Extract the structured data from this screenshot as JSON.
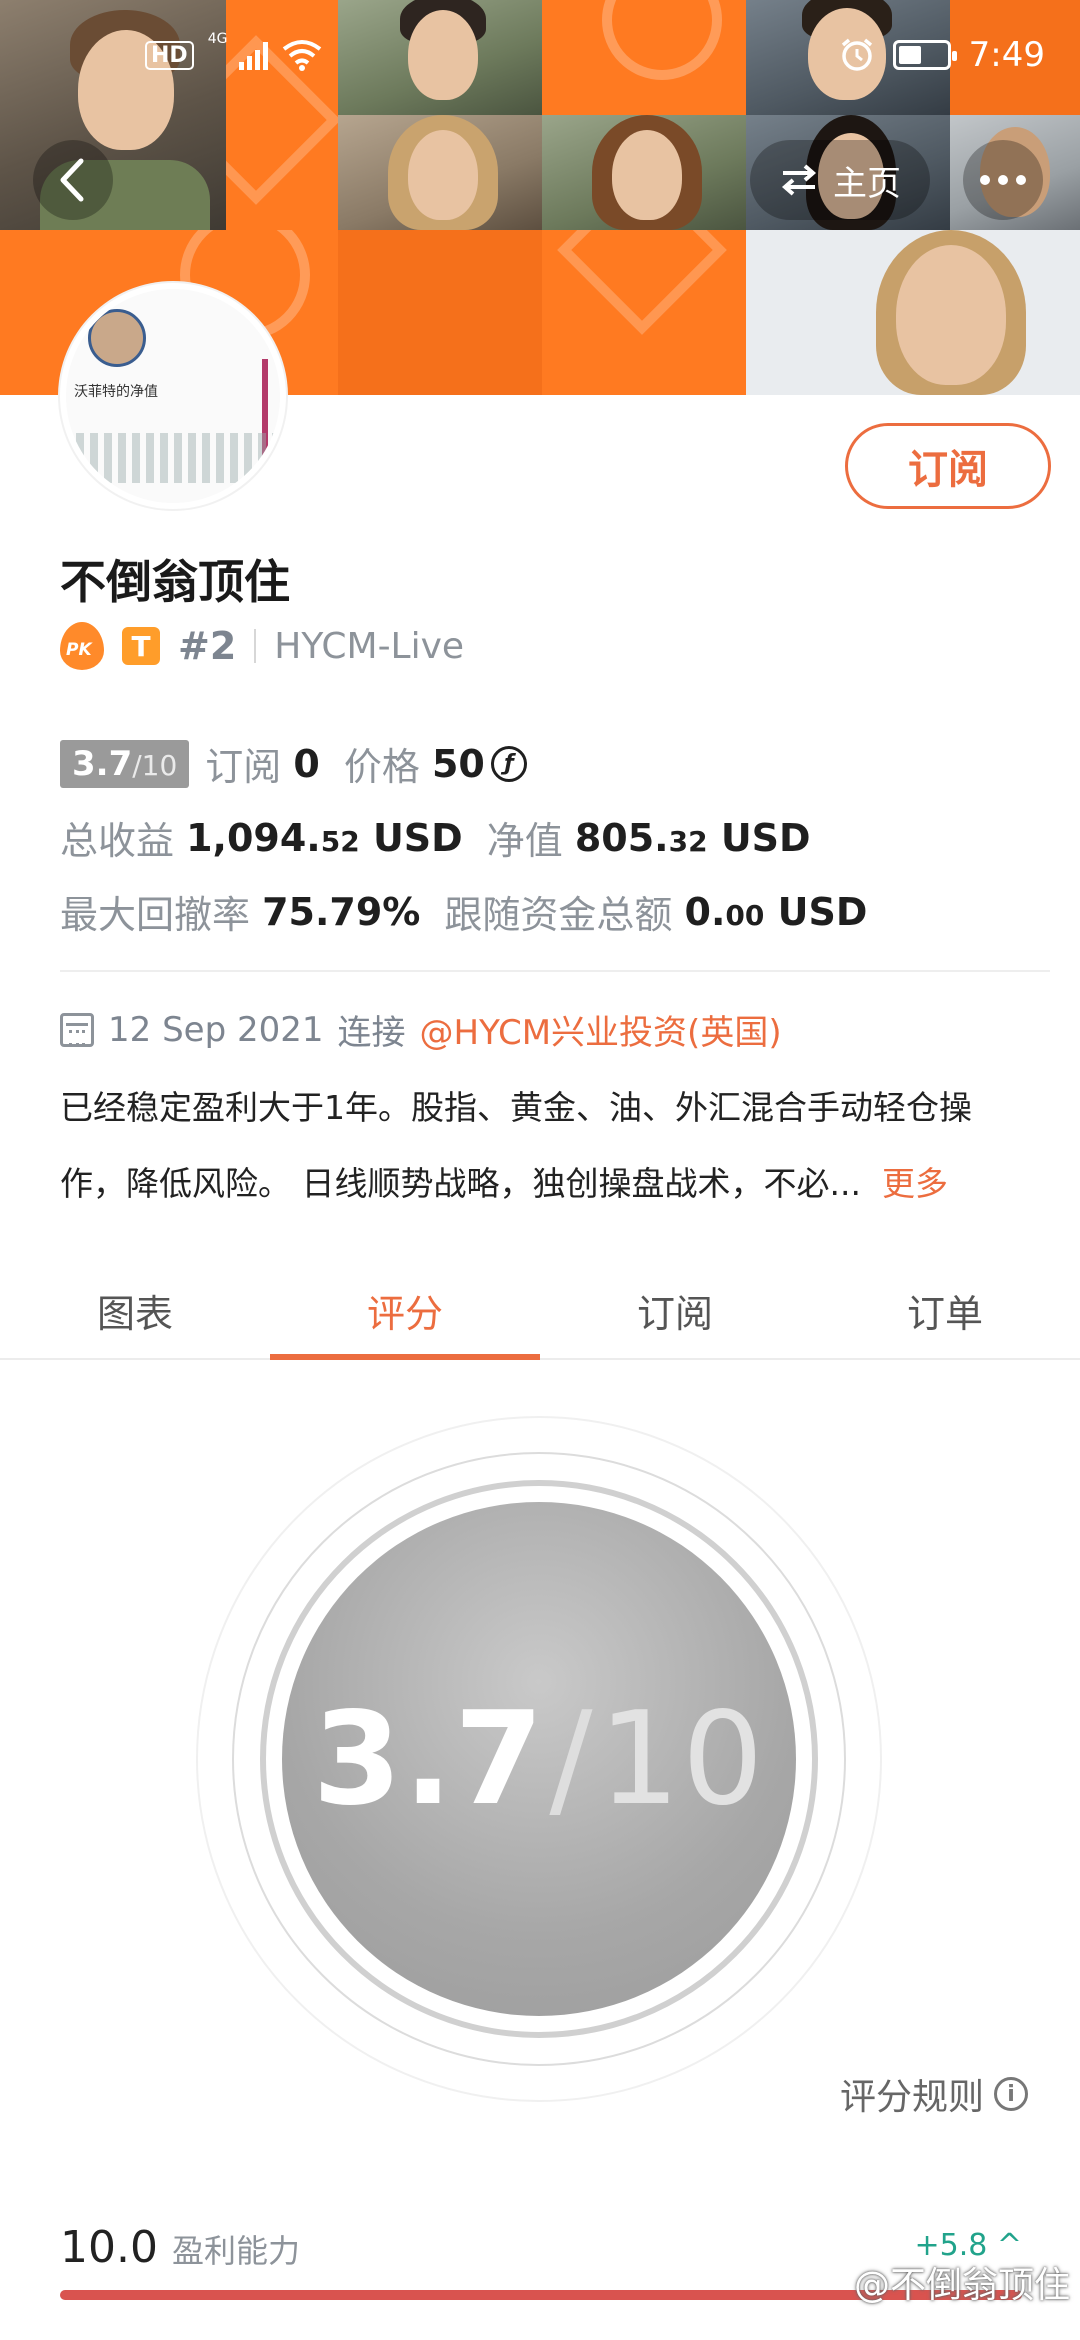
{
  "status_bar": {
    "network": "4G",
    "hd": "HD",
    "time": "7:49"
  },
  "header": {
    "home_label": "主页",
    "back_icon": "chevron-left-icon",
    "swap_icon": "swap-arrows-icon",
    "more_icon": "more-horizontal-icon"
  },
  "avatar": {
    "caption": "沃菲特的净值"
  },
  "subscribe_button": "订阅",
  "profile": {
    "name": "不倒翁顶住",
    "rank": "#2",
    "t_badge": "T",
    "pk_badge": "PK",
    "broker": "HYCM-Live"
  },
  "stats": {
    "rating_value": "3.7",
    "rating_max": "/10",
    "subscribe_label": "订阅",
    "subscribe_count": "0",
    "price_label": "价格",
    "price_value": "50",
    "price_icon": "ƒ",
    "total_profit_label": "总收益",
    "total_profit_main": "1,094.",
    "total_profit_dec": "52",
    "total_profit_unit": "USD",
    "net_value_label": "净值",
    "net_value_main": "805.",
    "net_value_dec": "32",
    "net_value_unit": "USD",
    "drawdown_label": "最大回撤率",
    "drawdown_value": "75.79%",
    "follow_label": "跟随资金总额",
    "follow_main": "0.",
    "follow_dec": "00",
    "follow_unit": "USD"
  },
  "connection": {
    "date": "12 Sep 2021",
    "connect_label": "连接",
    "broker_link": "@HYCM兴业投资(英国)"
  },
  "description": {
    "line1": "已经稳定盈利大于1年。股指、黄金、油、外汇混合手动轻仓操",
    "line2": "作，降低风险。 日线顺势战略，独创操盘战术，不必...",
    "more": "更多"
  },
  "tabs": [
    {
      "label": "图表"
    },
    {
      "label": "评分"
    },
    {
      "label": "订阅"
    },
    {
      "label": "订单"
    }
  ],
  "score": {
    "value": "3.7",
    "slash": "/",
    "max": "10"
  },
  "rules_label": "评分规则",
  "metrics": [
    {
      "value": "10.0",
      "label": "盈利能力",
      "delta": "+5.8 ^",
      "fill_percent": 100
    }
  ],
  "watermark": "@不倒翁顶住",
  "colors": {
    "accent": "#ec6d3f",
    "banner": "#ff7a21",
    "score_disc": "#a7a7a7",
    "positive": "#21a38b",
    "bar": "#d9534f"
  }
}
